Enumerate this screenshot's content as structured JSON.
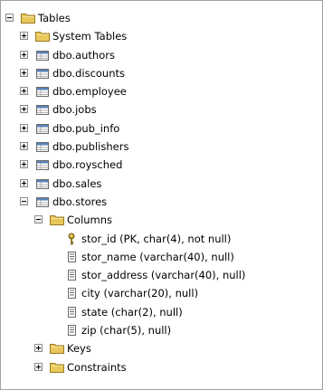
{
  "tree": {
    "root": {
      "label": "Tables"
    },
    "system_tables": {
      "label": "System Tables"
    },
    "tables": [
      {
        "label": "dbo.authors"
      },
      {
        "label": "dbo.discounts"
      },
      {
        "label": "dbo.employee"
      },
      {
        "label": "dbo.jobs"
      },
      {
        "label": "dbo.pub_info"
      },
      {
        "label": "dbo.publishers"
      },
      {
        "label": "dbo.roysched"
      },
      {
        "label": "dbo.sales"
      },
      {
        "label": "dbo.stores"
      }
    ],
    "columns_folder": {
      "label": "Columns"
    },
    "columns": [
      {
        "label": "stor_id (PK, char(4), not null)",
        "icon": "key-icon"
      },
      {
        "label": "stor_name (varchar(40), null)",
        "icon": "column-icon"
      },
      {
        "label": "stor_address (varchar(40), null)",
        "icon": "column-icon"
      },
      {
        "label": "city (varchar(20), null)",
        "icon": "column-icon"
      },
      {
        "label": "state (char(2), null)",
        "icon": "column-icon"
      },
      {
        "label": "zip (char(5), null)",
        "icon": "column-icon"
      }
    ],
    "keys_folder": {
      "label": "Keys"
    },
    "constraints_folder": {
      "label": "Constraints"
    }
  },
  "colors": {
    "folder": "#e8c85a",
    "table_icon": "#5b83b8",
    "key": "#c8a020",
    "border": "#a0a0a0"
  }
}
